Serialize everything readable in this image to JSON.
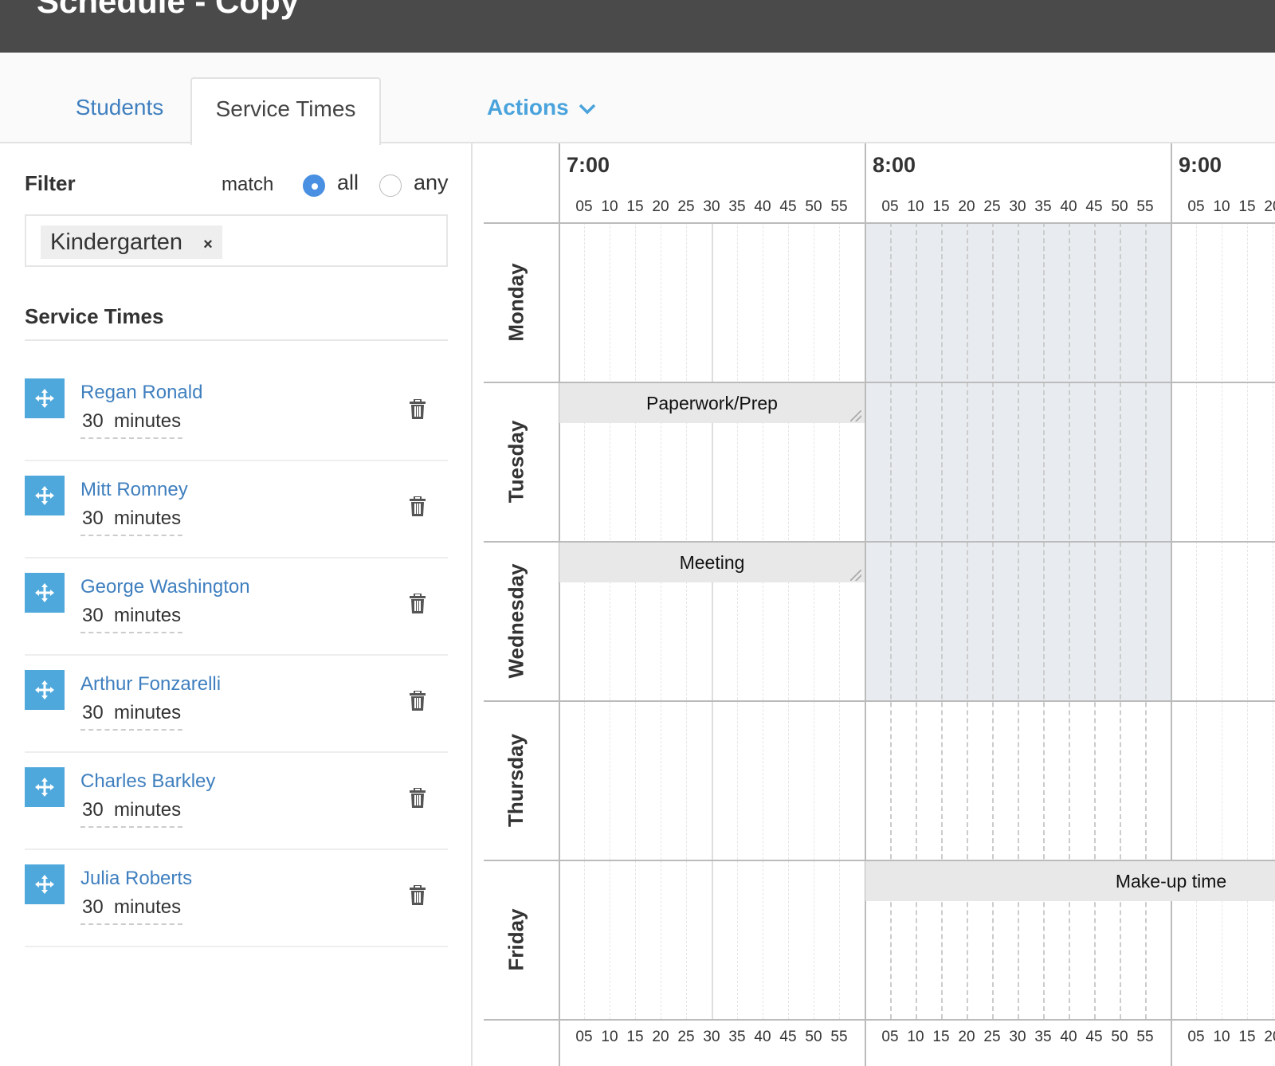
{
  "header": {
    "title": "Schedule - Copy"
  },
  "tabs": [
    {
      "label": "Students"
    },
    {
      "label": "Service Times"
    }
  ],
  "actions": {
    "label": "Actions",
    "icon": "chevron-down-icon"
  },
  "colors": {
    "accent": "#4fa8dc",
    "link": "#3f7fbf",
    "header_bg": "#4a4a4a",
    "highlight": "#e8ecf0",
    "event_bg": "#e8e8e8"
  },
  "filter": {
    "title": "Filter",
    "match_label": "match",
    "options": [
      "all",
      "any"
    ],
    "selected": "all",
    "tags": [
      {
        "label": "Kindergarten",
        "remove": "×"
      }
    ]
  },
  "service_times": {
    "title": "Service Times",
    "unit": "minutes",
    "items": [
      {
        "name": "Regan Ronald",
        "duration": "30"
      },
      {
        "name": "Mitt Romney",
        "duration": "30"
      },
      {
        "name": "George Washington",
        "duration": "30"
      },
      {
        "name": "Arthur Fonzarelli",
        "duration": "30"
      },
      {
        "name": "Charles Barkley",
        "duration": "30"
      },
      {
        "name": "Julia Roberts",
        "duration": "30"
      }
    ]
  },
  "calendar": {
    "hours": [
      "7:00",
      "8:00",
      "9:00"
    ],
    "minute_ticks": [
      "05",
      "10",
      "15",
      "20",
      "25",
      "30",
      "35",
      "40",
      "45",
      "50",
      "55"
    ],
    "days": [
      "Monday",
      "Tuesday",
      "Wednesday",
      "Thursday",
      "Friday"
    ],
    "highlight": {
      "days": [
        "Monday",
        "Tuesday",
        "Wednesday"
      ],
      "start": "8:00",
      "end": "9:00"
    },
    "events": [
      {
        "label": "Paperwork/Prep",
        "day": "Tuesday",
        "start": "7:00",
        "end": "8:00",
        "resizable": true
      },
      {
        "label": "Meeting",
        "day": "Wednesday",
        "start": "7:00",
        "end": "8:00",
        "resizable": true
      },
      {
        "label": "Make-up time",
        "day": "Friday",
        "start": "8:00",
        "end": "10:00",
        "resizable": false
      }
    ]
  }
}
